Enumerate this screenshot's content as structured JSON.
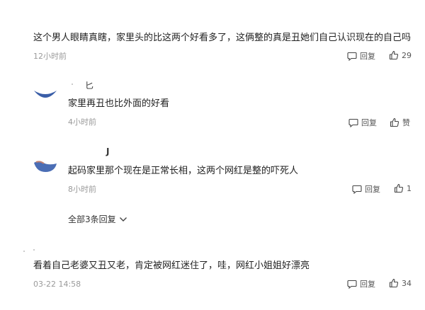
{
  "comments": [
    {
      "text": "这个男人眼睛真瞎，家里头的比这两个好看多了，这俩整的真是丑她们自己认识现在的自己吗",
      "time": "12小时前",
      "reply_label": "回复",
      "like_count": "29"
    },
    {
      "user_initial": "匕",
      "text": "家里再丑也比外面的好看",
      "time": "4小时前",
      "reply_label": "回复",
      "like_label": "赞"
    },
    {
      "user_initial": "J",
      "text": "起码家里那个现在是正常长相，这两个网红是整的吓死人",
      "time": "8小时前",
      "reply_label": "回复",
      "like_count": "1"
    },
    {
      "text": "看着自己老婆又丑又老，肯定被网红迷住了，哇，网红小姐姐好漂亮",
      "time": "03-22 14:58",
      "reply_label": "回复",
      "like_count": "34"
    }
  ],
  "expand_replies": "全部3条回复",
  "colors": {
    "text": "#222222",
    "meta": "#9a9a9a",
    "avatar_blue": "#3a5ea8"
  },
  "icons": {
    "reply": "comment-bubble-icon",
    "like": "thumbs-up-icon",
    "expand": "chevron-down-icon"
  }
}
